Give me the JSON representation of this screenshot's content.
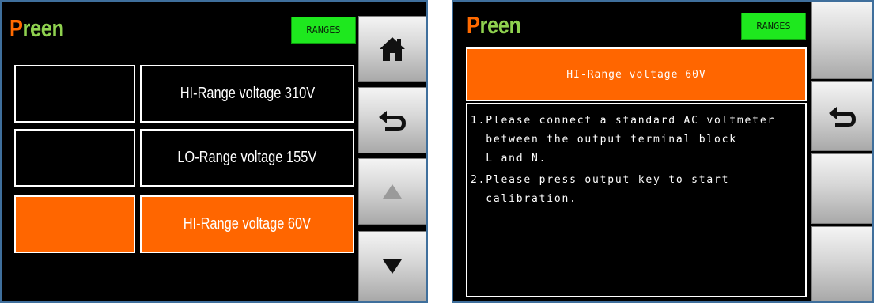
{
  "left_panel": {
    "logo": {
      "first_letter": "P",
      "rest": "reen"
    },
    "ranges_button": "RANGES",
    "range_items": [
      {
        "label": "HI-Range voltage 310V",
        "selected": false
      },
      {
        "label": "LO-Range voltage 155V",
        "selected": false
      },
      {
        "label": "HI-Range voltage 60V",
        "selected": true
      }
    ],
    "side_buttons": [
      "home-icon",
      "back-arrow-icon",
      "arrow-up-icon",
      "arrow-down-icon"
    ]
  },
  "right_panel": {
    "logo": {
      "first_letter": "P",
      "rest": "reen"
    },
    "ranges_button": "RANGES",
    "title": "HI-Range voltage 60V",
    "instructions": [
      "1.Please connect a standard AC voltmeter",
      "  between the output terminal block",
      "  L and N.",
      "2.Please press output key to start",
      "  calibration."
    ],
    "side_buttons": [
      "blank",
      "back-arrow-icon",
      "blank",
      "blank"
    ]
  },
  "colors": {
    "accent_orange": "#ff6600",
    "logo_green": "#8fd14f",
    "ranges_green": "#1ee81e",
    "frame_blue": "#3f6f9c"
  }
}
